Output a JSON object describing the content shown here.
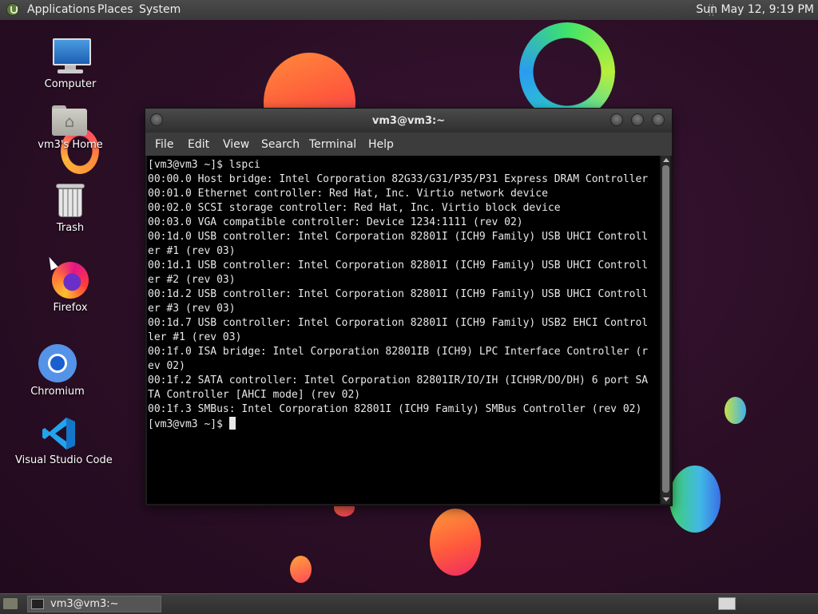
{
  "top_panel": {
    "menus": [
      "Applications",
      "Places",
      "System"
    ],
    "clock": "Sun May 12, 9:19 PM"
  },
  "desktop_icons": [
    {
      "label": "Computer",
      "icon": "computer-icon"
    },
    {
      "label": "vm3's Home",
      "icon": "home-folder-icon"
    },
    {
      "label": "Trash",
      "icon": "trash-icon"
    },
    {
      "label": "Firefox",
      "icon": "firefox-icon"
    },
    {
      "label": "Chromium",
      "icon": "chromium-icon"
    },
    {
      "label": "Visual Studio Code",
      "icon": "vscode-icon"
    }
  ],
  "terminal": {
    "title": "vm3@vm3:~",
    "menu": [
      "File",
      "Edit",
      "View",
      "Search",
      "Terminal",
      "Help"
    ],
    "lines": [
      "[vm3@vm3 ~]$ lspci",
      "00:00.0 Host bridge: Intel Corporation 82G33/G31/P35/P31 Express DRAM Controller",
      "00:01.0 Ethernet controller: Red Hat, Inc. Virtio network device",
      "00:02.0 SCSI storage controller: Red Hat, Inc. Virtio block device",
      "00:03.0 VGA compatible controller: Device 1234:1111 (rev 02)",
      "00:1d.0 USB controller: Intel Corporation 82801I (ICH9 Family) USB UHCI Controll",
      "er #1 (rev 03)",
      "00:1d.1 USB controller: Intel Corporation 82801I (ICH9 Family) USB UHCI Controll",
      "er #2 (rev 03)",
      "00:1d.2 USB controller: Intel Corporation 82801I (ICH9 Family) USB UHCI Controll",
      "er #3 (rev 03)",
      "00:1d.7 USB controller: Intel Corporation 82801I (ICH9 Family) USB2 EHCI Control",
      "ler #1 (rev 03)",
      "00:1f.0 ISA bridge: Intel Corporation 82801IB (ICH9) LPC Interface Controller (r",
      "ev 02)",
      "00:1f.2 SATA controller: Intel Corporation 82801IR/IO/IH (ICH9R/DO/DH) 6 port SA",
      "TA Controller [AHCI mode] (rev 02)",
      "00:1f.3 SMBus: Intel Corporation 82801I (ICH9 Family) SMBus Controller (rev 02)"
    ],
    "prompt": "[vm3@vm3 ~]$ "
  },
  "taskbar": {
    "window_label": "vm3@vm3:~"
  }
}
